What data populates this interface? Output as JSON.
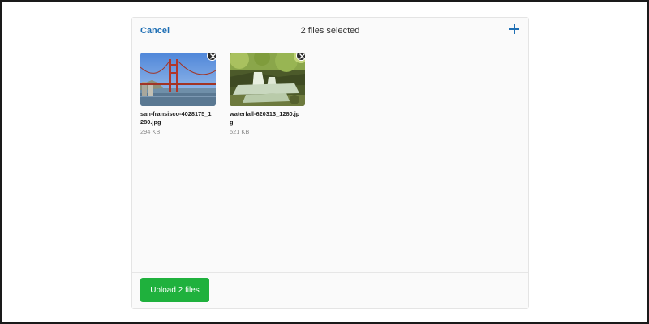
{
  "header": {
    "cancel_label": "Cancel",
    "title": "2 files selected",
    "add_icon": "plus-icon"
  },
  "files": [
    {
      "name": "san-fransisco-4028175_1280.jpg",
      "size": "294 KB",
      "thumbnail": "golden-gate-bridge"
    },
    {
      "name": "waterfall-620313_1280.jpg",
      "size": "521 KB",
      "thumbnail": "waterfall"
    }
  ],
  "footer": {
    "upload_label": "Upload 2 files"
  },
  "colors": {
    "accent": "#1f6fb4",
    "upload_button": "#1fb13d"
  }
}
